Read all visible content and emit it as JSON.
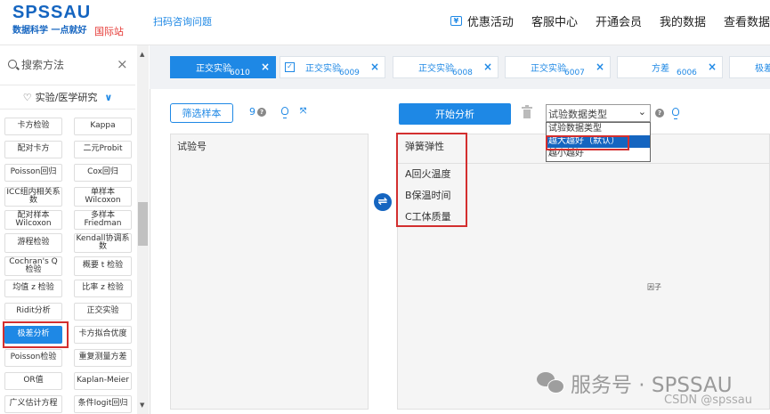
{
  "header": {
    "logo": "SPSSAU",
    "slogan": "数据科学 一点就好",
    "intl_label": "国际站",
    "scan_link": "扫码咨询问题",
    "nav": [
      "优惠活动",
      "客服中心",
      "开通会员",
      "我的数据",
      "查看数据"
    ],
    "promo_icon": "coupon-icon"
  },
  "sidebar": {
    "search_placeholder": "搜索方法",
    "clear": "×",
    "category_label": "实验/医学研究",
    "methods": [
      "卡方检验",
      "Kappa",
      "配对卡方",
      "二元Probit",
      "Poisson回归",
      "Cox回归",
      "ICC组内相关系数",
      "单样本Wilcoxon",
      "配对样本Wilcoxon",
      "多样本Friedman",
      "游程检验",
      "Kendall协调系数",
      "Cochran's Q检验",
      "概要 t 检验",
      "均值 z 检验",
      "比率 z 检验",
      "Ridit分析",
      "正交实验",
      "极差分析",
      "卡方拟合优度",
      "Poisson检验",
      "重复测量方差",
      "OR值",
      "Kaplan-Meier",
      "广义估计方程",
      "条件logit回归"
    ],
    "active_method": "极差分析"
  },
  "tabs": [
    {
      "label": "正交实验",
      "id": "6010",
      "active": true
    },
    {
      "label": "正交实验",
      "id": "6009",
      "active": false,
      "checkbox": true
    },
    {
      "label": "正交实验",
      "id": "6008",
      "active": false
    },
    {
      "label": "正交实验",
      "id": "6007",
      "active": false
    },
    {
      "label": "方差",
      "id": "6006",
      "active": false
    },
    {
      "label": "极差",
      "id": "",
      "active": false
    }
  ],
  "analysis": {
    "filter_button": "筛选样本",
    "variable_count": "9",
    "left_box_header": "试验号",
    "start_button": "开始分析",
    "select_value": "试验数据类型",
    "dropdown_options": [
      "试验数据类型",
      "越大越好（默认）",
      "越小越好"
    ],
    "selected_option": "越大越好（默认）",
    "right_box_header": "弹簧弹性",
    "factors": [
      "A回火温度",
      "B保温时间",
      "C工体质量"
    ],
    "factor_label": "因子",
    "help": "?"
  },
  "watermark": {
    "text": "服务号 · SPSSAU",
    "csdn": "CSDN @spssau"
  },
  "colors": {
    "brand": "#1565c0",
    "accent": "#1e88e5",
    "highlight": "#d32f2f"
  }
}
